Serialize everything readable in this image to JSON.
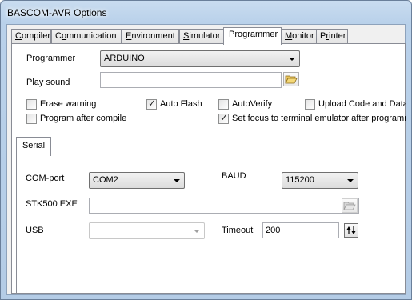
{
  "window": {
    "title": "BASCOM-AVR Options"
  },
  "tabs": [
    {
      "label": "Compiler",
      "u": "C",
      "rest": "ompiler"
    },
    {
      "label": "Communication",
      "u": "o",
      "pre": "C",
      "rest": "mmunication"
    },
    {
      "label": "Environment",
      "u": "E",
      "rest": "nvironment"
    },
    {
      "label": "Simulator",
      "u": "S",
      "rest": "imulator"
    },
    {
      "label": "Programmer",
      "u": "P",
      "rest": "rogrammer"
    },
    {
      "label": "Monitor",
      "u": "M",
      "rest": "onitor"
    },
    {
      "label": "Printer",
      "u": "r",
      "pre": "P",
      "rest": "inter"
    }
  ],
  "programmer": {
    "label": "Programmer",
    "value": "ARDUINO"
  },
  "play_sound": {
    "label": "Play sound",
    "value": ""
  },
  "checkboxes": {
    "erase_warning": {
      "label": "Erase warning",
      "checked": false
    },
    "auto_flash": {
      "label": "Auto Flash",
      "checked": true
    },
    "auto_verify": {
      "label": "AutoVerify",
      "checked": false
    },
    "upload_code": {
      "label": "Upload Code and Data",
      "checked": false
    },
    "program_after_compile": {
      "label": "Program after compile",
      "checked": false
    },
    "set_focus": {
      "label": "Set focus to terminal emulator after programming",
      "checked": true
    }
  },
  "serial": {
    "tab_label": "Serial",
    "com_port_label": "COM-port",
    "com_port_value": "COM2",
    "baud_label": "BAUD",
    "baud_value": "115200",
    "stk500_label": "STK500 EXE",
    "stk500_value": "",
    "usb_label": "USB",
    "usb_value": "",
    "timeout_label": "Timeout",
    "timeout_value": "200"
  },
  "icons": {
    "open_folder": "open-folder-icon",
    "spin": "up-down-icon"
  }
}
